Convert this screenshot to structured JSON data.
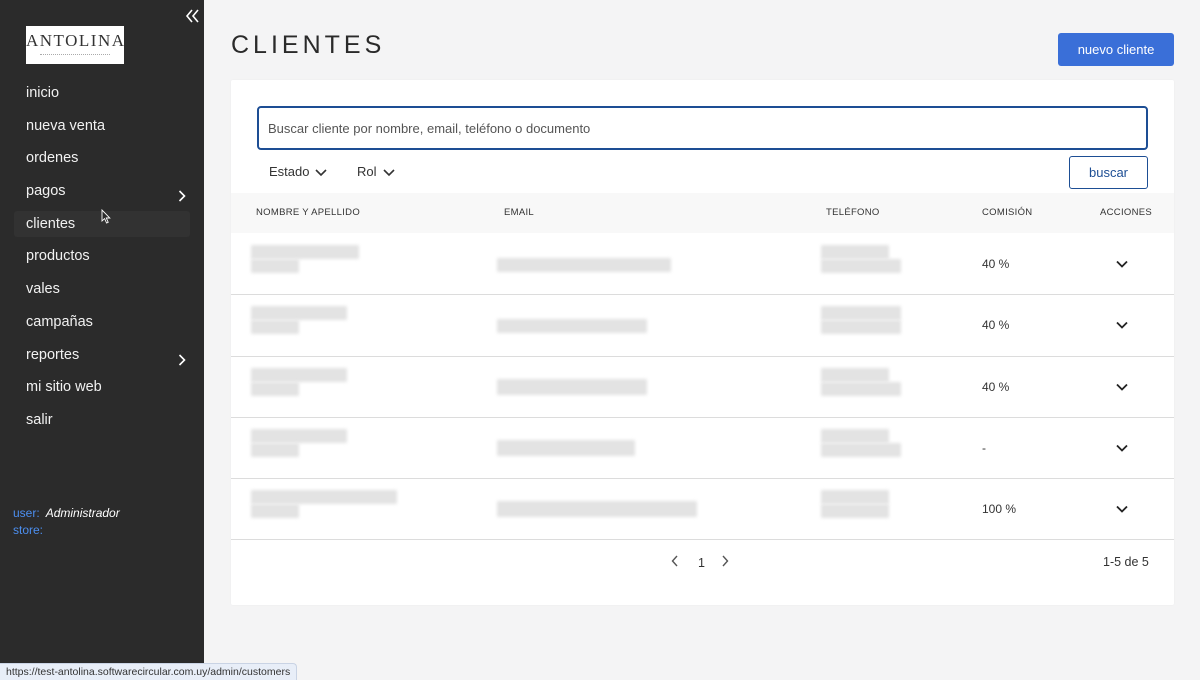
{
  "logo": {
    "text": "ANTOLINA"
  },
  "nav": [
    {
      "label": "inicio"
    },
    {
      "label": "nueva venta"
    },
    {
      "label": "ordenes"
    },
    {
      "label": "pagos",
      "submenu": true
    },
    {
      "label": "clientes",
      "active": true
    },
    {
      "label": "productos"
    },
    {
      "label": "vales"
    },
    {
      "label": "campañas"
    },
    {
      "label": "reportes",
      "submenu": true
    },
    {
      "label": "mi sitio web"
    },
    {
      "label": "salir"
    }
  ],
  "user": {
    "user_label": "user:",
    "user_value": "Administrador",
    "store_label": "store:",
    "store_value": ""
  },
  "page": {
    "title": "CLIENTES",
    "new_button": "nuevo cliente"
  },
  "search": {
    "placeholder": "Buscar cliente por nombre, email, teléfono o documento",
    "value": "",
    "button": "buscar"
  },
  "filters": [
    {
      "label": "Estado"
    },
    {
      "label": "Rol"
    }
  ],
  "table": {
    "headers": [
      "NOMBRE Y APELLIDO",
      "EMAIL",
      "TELÉFONO",
      "COMISIÓN",
      "ACCIONES"
    ],
    "rows": [
      {
        "comision": "40 %"
      },
      {
        "comision": "40 %"
      },
      {
        "comision": "40 %"
      },
      {
        "comision": "-"
      },
      {
        "comision": "100 %"
      }
    ]
  },
  "pagination": {
    "current": "1",
    "info": "1-5 de 5"
  },
  "status_url": "https://test-antolina.softwarecircular.com.uy/admin/customers",
  "colors": {
    "sidebar_bg": "#2b2b2b",
    "primary": "#3a6fd8",
    "accent_border": "#1d4e94",
    "user_label": "#4c8ff0"
  }
}
